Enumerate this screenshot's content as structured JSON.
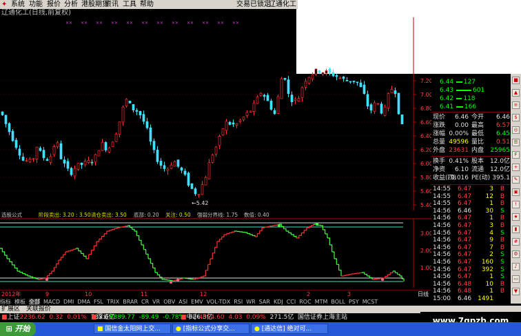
{
  "menu": {
    "items": [
      "系统",
      "功能",
      "报价",
      "分析",
      "港股期货",
      "资讯",
      "工具",
      "帮助"
    ],
    "status": "交易已锁定",
    "stock_title": "辽通化工"
  },
  "chart_header": {
    "title": "辽通化工(日线,前复权)"
  },
  "main_chart": {
    "y_ticks": [
      "7.20",
      "7.00",
      "6.80",
      "6.60",
      "6.40",
      "6.20",
      "6.00",
      "5.80",
      "5.60",
      "5.40"
    ],
    "low_label": "←5.42",
    "colors": {
      "up": "#ff3030",
      "down": "#40e0ff",
      "grid": "#800000",
      "axis": "#c00000"
    }
  },
  "indicator": {
    "header": [
      {
        "text": "选股公式",
        "color": "#c0c0c0"
      },
      {
        "text": "阶段卖出: 3.20 : 3.50",
        "color": "#e0e000"
      },
      {
        "text": "清仓卖出: 3.50",
        "color": "#e0e000"
      },
      {
        "text": "底部: 0.20",
        "color": "#c0c0c0"
      },
      {
        "text": "关注: 0.50",
        "color": "#e0e000"
      },
      {
        "text": "强弱分界线: 1.75",
        "color": "#c0c0c0"
      },
      {
        "text": "数值: 0.40",
        "color": "#c0c0c0"
      }
    ],
    "y_ticks": [
      "3.00",
      "2.00",
      "1.00"
    ],
    "colors": {
      "up": "#ff3030",
      "down": "#40ff40"
    }
  },
  "date_bar": {
    "labels": [
      {
        "t": "2012年",
        "x": 2
      },
      {
        "t": "9",
        "x": 66
      },
      {
        "t": "10",
        "x": 123
      },
      {
        "t": "11",
        "x": 204
      },
      {
        "t": "12",
        "x": 290
      },
      {
        "t": "2",
        "x": 445
      },
      {
        "t": "3",
        "x": 504
      }
    ],
    "period": "日线"
  },
  "order_book": {
    "sell": [
      {
        "price": "6.44",
        "vol": "127",
        "bar": 40
      },
      {
        "price": "6.43",
        "vol": "601",
        "bar": 100
      },
      {
        "price": "6.42",
        "vol": "118",
        "bar": 38
      },
      {
        "price": "6.41",
        "vol": "166",
        "bar": 45
      }
    ]
  },
  "quote": {
    "rows": [
      {
        "l1": "现价",
        "v1": "6.46",
        "c1": "white",
        "l2": "今开",
        "v2": "6.46",
        "c2": "white"
      },
      {
        "l1": "涨跌",
        "v1": "0.00",
        "c1": "white",
        "l2": "最高",
        "v2": "6.57",
        "c2": "red"
      },
      {
        "l1": "涨幅",
        "v1": "0.00%",
        "c1": "white",
        "l2": "最低",
        "v2": "6.45",
        "c2": "green"
      },
      {
        "l1": "总量",
        "v1": "49596",
        "c1": "yellow",
        "l2": "量比",
        "v2": "0.51",
        "c2": "red"
      },
      {
        "l1": "外盘",
        "v1": "23631",
        "c1": "red",
        "l2": "内盘",
        "v2": "25965",
        "c2": "green"
      }
    ],
    "rows2": [
      {
        "l1": "换手",
        "v1": "0.41%",
        "l2": "股本",
        "v2": "12.0亿"
      },
      {
        "l1": "净资",
        "v1": "6.10",
        "l2": "流通",
        "v2": "12.0亿"
      },
      {
        "l1": "收益(四)",
        "v1": "0.016",
        "l2": "PE(动)",
        "v2": "395.1"
      }
    ]
  },
  "ticks": [
    {
      "t": "14:55",
      "p": "6.47",
      "pc": "red",
      "v": "3",
      "s": "B",
      "sc": "red"
    },
    {
      "t": "14:55",
      "p": "6.47",
      "pc": "red",
      "v": "12",
      "s": "B",
      "sc": "red"
    },
    {
      "t": "14:55",
      "p": "6.47",
      "pc": "red",
      "v": "1",
      "s": "B",
      "sc": "red"
    },
    {
      "t": "14:56",
      "p": "6.46",
      "pc": "white",
      "v": "30",
      "s": "S",
      "sc": "green"
    },
    {
      "t": "14:56",
      "p": "6.47",
      "pc": "red",
      "v": "1",
      "s": "B",
      "sc": "red"
    },
    {
      "t": "14:56",
      "p": "6.47",
      "pc": "red",
      "v": "3",
      "s": "B",
      "sc": "red"
    },
    {
      "t": "14:56",
      "p": "6.47",
      "pc": "red",
      "v": "4",
      "s": "S",
      "sc": "green"
    },
    {
      "t": "14:56",
      "p": "6.47",
      "pc": "red",
      "v": "9",
      "s": "B",
      "sc": "red"
    },
    {
      "t": "14:56",
      "p": "6.47",
      "pc": "red",
      "v": "7",
      "s": "B",
      "sc": "red"
    },
    {
      "t": "14:56",
      "p": "6.47",
      "pc": "red",
      "v": "2",
      "s": "S",
      "sc": "green"
    },
    {
      "t": "14:56",
      "p": "6.47",
      "pc": "red",
      "v": "160",
      "s": "S",
      "sc": "green"
    },
    {
      "t": "14:56",
      "p": "6.47",
      "pc": "red",
      "v": "392",
      "s": "S",
      "sc": "green"
    },
    {
      "t": "14:56",
      "p": "6.47",
      "pc": "red",
      "v": "1",
      "s": "S",
      "sc": "green"
    },
    {
      "t": "14:56",
      "p": "6.48",
      "pc": "red",
      "v": "10",
      "s": "B",
      "sc": "red"
    },
    {
      "t": "14:56",
      "p": "6.48",
      "pc": "red",
      "v": "1",
      "s": "B",
      "sc": "red"
    },
    {
      "t": "15:00",
      "p": "6.46",
      "pc": "white",
      "v": "1491",
      "s": "",
      "sc": "white"
    }
  ],
  "tabs": [
    "指标",
    "模板",
    "全部",
    "MACD",
    "DMI",
    "DMA",
    "FSL",
    "TRIX",
    "BRAR",
    "CR",
    "VR",
    "OBV",
    "ASI",
    "EMV",
    "VOL-TDX",
    "RSI",
    "WR",
    "SAR",
    "KDJ",
    "CCI",
    "ROC",
    "MTM",
    "BOLL",
    "PSY",
    "MCST"
  ],
  "ext_bar": {
    "items": [
      "扩展区",
      "关联报价"
    ]
  },
  "index_bar": [
    {
      "name": "上证",
      "val": "2236.62",
      "chg": "0.32",
      "pct": "0.01%",
      "amt": "733.6亿"
    },
    {
      "name": "深证",
      "val": "8889.77",
      "chg": "-89.49",
      "pct": "-0.78%",
      "amt": "626.3亿"
    },
    {
      "name": "中小",
      "val": "4614.60",
      "chg": "4.03",
      "pct": "0.09%",
      "amt": "271.5亿"
    }
  ],
  "index_status": "国信证券上海主站",
  "taskbar": {
    "start": "开始",
    "tasks": [
      "国信金太阳网上交...",
      "[指标公式分享交...",
      "[通达信] 绝对可..."
    ]
  },
  "watermark": "www.7gpzb.com"
}
